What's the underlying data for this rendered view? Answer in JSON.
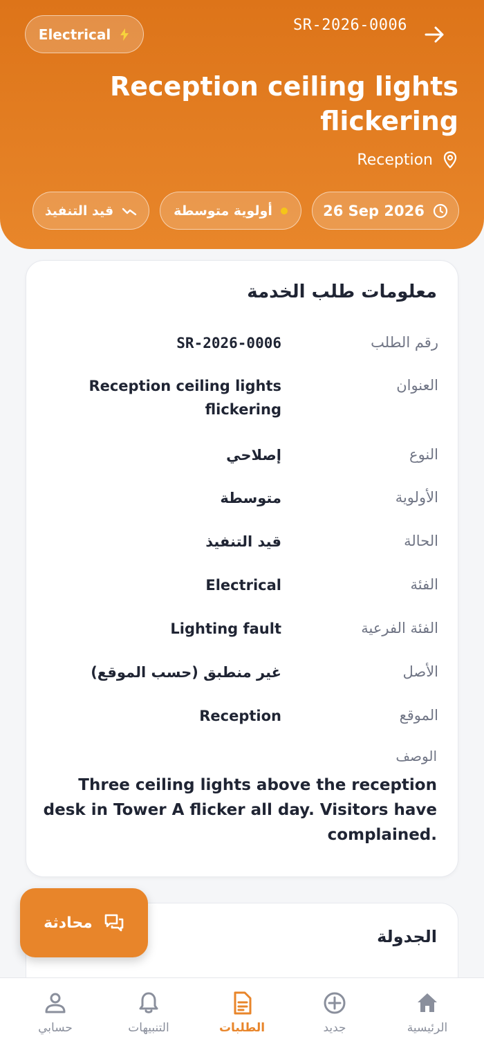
{
  "header": {
    "category_chip": "Electrical",
    "reference": "SR-2026-0006",
    "title": "Reception ceiling lights flickering",
    "location": "Reception",
    "pills": {
      "status": "قيد التنفيذ",
      "priority": "أولوية متوسطة",
      "date": "26 Sep 2026"
    }
  },
  "info_card": {
    "title": "معلومات طلب الخدمة",
    "rows": [
      {
        "label": "رقم الطلب",
        "value": "SR-2026-0006"
      },
      {
        "label": "العنوان",
        "value": "Reception ceiling lights flickering"
      },
      {
        "label": "النوع",
        "value": "إصلاحي"
      },
      {
        "label": "الأولوية",
        "value": "متوسطة"
      },
      {
        "label": "الحالة",
        "value": "قيد التنفيذ"
      },
      {
        "label": "الفئة",
        "value": "Electrical"
      },
      {
        "label": "الفئة الفرعية",
        "value": "Lighting fault"
      },
      {
        "label": "الأصل",
        "value": "غير منطبق (حسب الموقع)"
      },
      {
        "label": "الموقع",
        "value": "Reception"
      }
    ],
    "description_label": "الوصف",
    "description": "Three ceiling lights above the reception desk in Tower A flicker all day. Visitors have complained."
  },
  "schedule_card": {
    "title": "الجدولة"
  },
  "chat_fab": {
    "label": "محادثة"
  },
  "bottom_nav": {
    "items": [
      {
        "label": "حسابي",
        "icon": "person-icon"
      },
      {
        "label": "التنبيهات",
        "icon": "bell-icon"
      },
      {
        "label": "الطلبات",
        "icon": "document-icon"
      },
      {
        "label": "جديد",
        "icon": "plus-circle-icon"
      },
      {
        "label": "الرئيسية",
        "icon": "home-icon"
      }
    ],
    "active_index": 2
  },
  "colors": {
    "brand_orange": "#e8852a",
    "header_orange": "#dd7419",
    "priority_dot": "#f5c518",
    "text_dark": "#1f2433",
    "text_muted": "#707585"
  }
}
